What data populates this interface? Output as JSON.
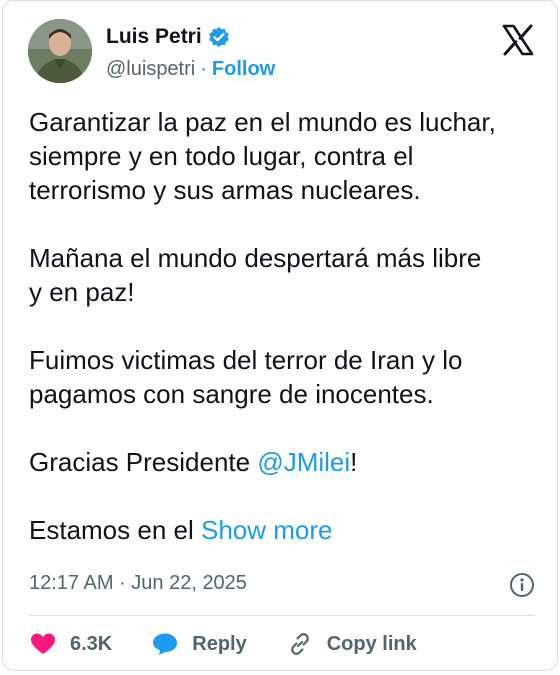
{
  "author": {
    "name": "Luis Petri",
    "handle": "@luispetri",
    "separator": "·",
    "follow_label": "Follow",
    "verified": true
  },
  "tweet": {
    "paragraph1": "Garantizar la paz en el mundo es luchar,\nsiempre y en todo lugar, contra el\nterrorismo y sus armas nucleares.",
    "paragraph2": "Mañana el mundo despertará más libre\ny en paz!",
    "paragraph3": "Fuimos victimas del terror de Iran y lo\npagamos con sangre de inocentes.",
    "paragraph4_prefix": "Gracias Presidente ",
    "paragraph4_mention": "@JMilei",
    "paragraph4_suffix": "!",
    "paragraph5_text": "Estamos en el ",
    "show_more_label": "Show more"
  },
  "timestamp": "12:17 AM · Jun 22, 2025",
  "actions": {
    "like_count": "6.3K",
    "reply_label": "Reply",
    "copy_link_label": "Copy link"
  },
  "colors": {
    "accent": "#1d9bf0",
    "like": "#f91880",
    "text": "#0f1419",
    "secondary": "#536471"
  },
  "icons": {
    "brand": "x-logo-icon",
    "verified": "verified-badge-icon",
    "info": "info-icon",
    "like": "heart-icon",
    "reply": "speech-bubble-icon",
    "copy_link": "link-icon"
  }
}
